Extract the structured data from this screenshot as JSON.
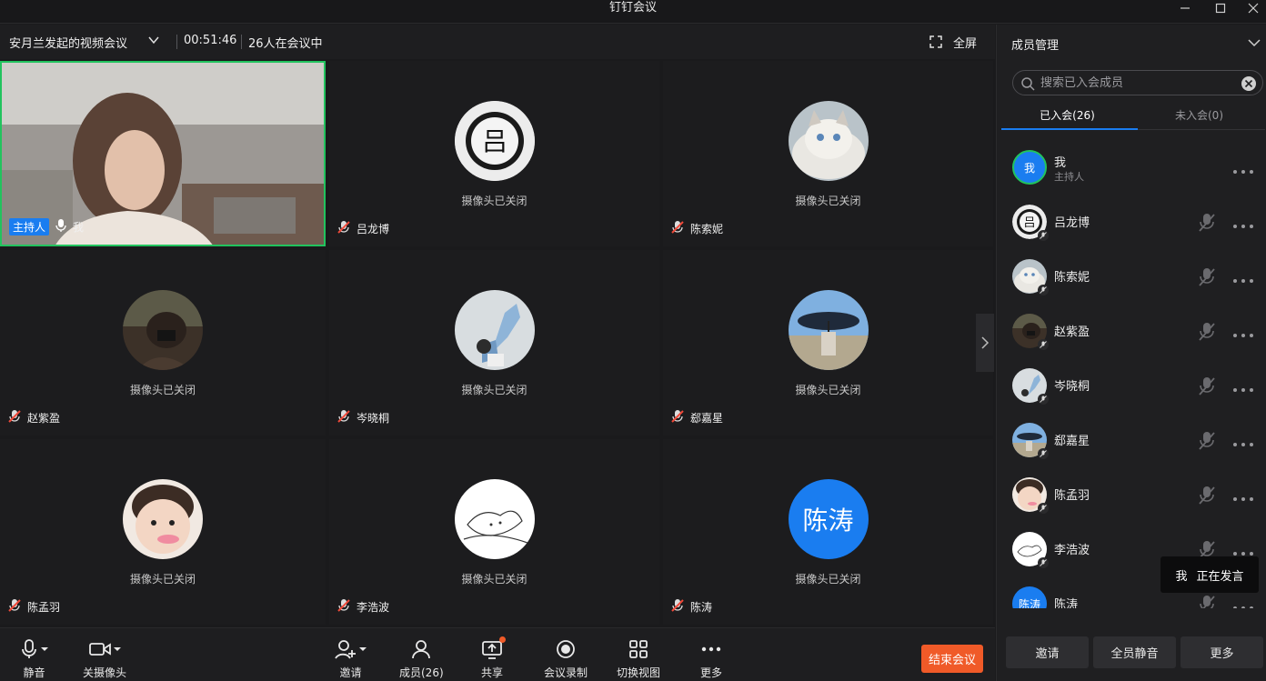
{
  "window": {
    "title": "钉钉会议"
  },
  "infobar": {
    "topic": "安月兰发起的视频会议",
    "duration": "00:51:46",
    "participants": "26人在会议中",
    "fullscreen_label": "全屏"
  },
  "tiles": {
    "camera_off_text": "摄像头已关闭",
    "host_badge": "主持人",
    "self_name": "我",
    "t1": "吕龙博",
    "t2": "陈索妮",
    "t3": "赵紫盈",
    "t4": "岑晓桐",
    "t5": "郄嘉星",
    "t6": "陈孟羽",
    "t7": "李浩波",
    "t8": "陈涛",
    "t8_avatar_text": "陈涛"
  },
  "toolbar": {
    "mute": "静音",
    "camera": "关摄像头",
    "invite": "邀请",
    "members": "成员(26)",
    "share": "共享",
    "record": "会议录制",
    "switch_view": "切换视图",
    "more": "更多",
    "end": "结束会议"
  },
  "panel": {
    "title": "成员管理",
    "search_placeholder": "搜索已入会成员",
    "tab_joined": "已入会(26)",
    "tab_not_joined": "未入会(0)",
    "members": [
      {
        "name": "我",
        "role": "主持人",
        "avatar_text": "我"
      },
      {
        "name": "吕龙博"
      },
      {
        "name": "陈索妮"
      },
      {
        "name": "赵紫盈"
      },
      {
        "name": "岑晓桐"
      },
      {
        "name": "郄嘉星"
      },
      {
        "name": "陈孟羽"
      },
      {
        "name": "李浩波"
      },
      {
        "name": "陈涛",
        "avatar_text": "陈涛"
      }
    ],
    "speaking_label": "我",
    "speaking_text": "正在发言",
    "btn_invite": "邀请",
    "btn_mute_all": "全员静音",
    "btn_more": "更多"
  },
  "colors": {
    "accent": "#1a7df0",
    "end_button": "#f05a28",
    "host_border": "#22c35e"
  }
}
